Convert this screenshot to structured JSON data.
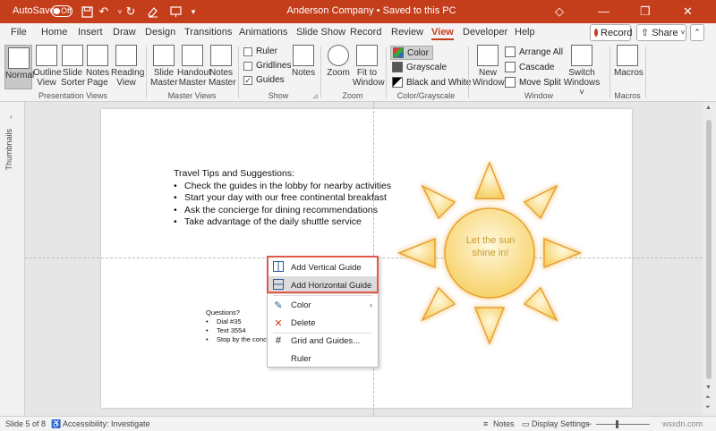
{
  "titlebar": {
    "autosave_label": "AutoSave",
    "autosave_state": "Off",
    "title": "Anderson Company • Saved to this PC",
    "accent": "#c43e1c"
  },
  "tabs": [
    {
      "label": "File"
    },
    {
      "label": "Home"
    },
    {
      "label": "Insert"
    },
    {
      "label": "Draw"
    },
    {
      "label": "Design"
    },
    {
      "label": "Transitions"
    },
    {
      "label": "Animations"
    },
    {
      "label": "Slide Show"
    },
    {
      "label": "Record"
    },
    {
      "label": "Review"
    },
    {
      "label": "View"
    },
    {
      "label": "Developer"
    },
    {
      "label": "Help"
    }
  ],
  "tab_active": "View",
  "header_buttons": {
    "record": "Record",
    "share": "Share"
  },
  "ribbon": {
    "presentation_views": {
      "label": "Presentation Views",
      "buttons": [
        {
          "line1": "Normal",
          "line2": ""
        },
        {
          "line1": "Outline",
          "line2": "View"
        },
        {
          "line1": "Slide",
          "line2": "Sorter"
        },
        {
          "line1": "Notes",
          "line2": "Page"
        },
        {
          "line1": "Reading",
          "line2": "View"
        }
      ]
    },
    "master_views": {
      "label": "Master Views",
      "buttons": [
        {
          "line1": "Slide",
          "line2": "Master"
        },
        {
          "line1": "Handout",
          "line2": "Master"
        },
        {
          "line1": "Notes",
          "line2": "Master"
        }
      ]
    },
    "show": {
      "label": "Show",
      "checkboxes": [
        {
          "label": "Ruler",
          "checked": false
        },
        {
          "label": "Gridlines",
          "checked": false
        },
        {
          "label": "Guides",
          "checked": true
        }
      ],
      "notes_label": "Notes"
    },
    "zoom": {
      "label": "Zoom",
      "buttons": [
        {
          "line1": "Zoom",
          "line2": ""
        },
        {
          "line1": "Fit to",
          "line2": "Window"
        }
      ]
    },
    "color_grayscale": {
      "label": "Color/Grayscale",
      "items": [
        "Color",
        "Grayscale",
        "Black and White"
      ]
    },
    "window": {
      "label": "Window",
      "new_window": {
        "line1": "New",
        "line2": "Window"
      },
      "items": [
        "Arrange All",
        "Cascade",
        "Move Split"
      ],
      "switch_windows": {
        "line1": "Switch",
        "line2": "Windows ˅"
      }
    },
    "macros": {
      "label": "Macros",
      "button": "Macros"
    }
  },
  "thumbnails_label": "Thumbnails",
  "slide": {
    "tips_title": "Travel Tips and Suggestions:",
    "tips": [
      "Check the guides in the lobby for nearby activities",
      "Start your day with our free continental breakfast",
      "Ask the concierge for dining recommendations",
      "Take advantage of the daily shuttle service"
    ],
    "questions_title": "Questions?",
    "questions": [
      "Dial #35",
      "Text 3554",
      "Stop by the concierge desk"
    ],
    "sun_text_line1": "Let the sun",
    "sun_text_line2": "shine in!"
  },
  "context_menu": {
    "items": [
      {
        "label": "Add Vertical Guide",
        "icon": "vertical-guide-icon"
      },
      {
        "label": "Add Horizontal Guide",
        "icon": "horizontal-guide-icon",
        "hover": true
      },
      {
        "label": "Color",
        "icon": "pen-color-icon",
        "submenu": true
      },
      {
        "label": "Delete",
        "icon": "delete-x-icon"
      },
      {
        "label": "Grid and Guides...",
        "icon": "grid-icon"
      },
      {
        "label": "Ruler",
        "icon": ""
      }
    ],
    "highlight_color": "#e05a4a"
  },
  "statusbar": {
    "slide_info": "Slide 5 of 8",
    "accessibility": "Accessibility: Investigate",
    "notes": "Notes",
    "display_settings": "Display Settings",
    "watermark": "wsxdn.com"
  }
}
